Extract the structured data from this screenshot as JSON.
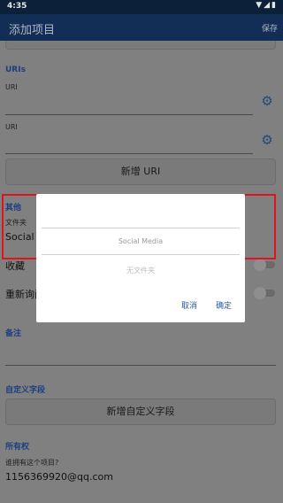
{
  "status_bar": {
    "time": "4:35",
    "icons": "▼◢▮"
  },
  "app_bar": {
    "title": "添加项目",
    "save": "保存"
  },
  "uris": {
    "title": "URIs",
    "fields": [
      {
        "label": "URI"
      },
      {
        "label": "URI"
      }
    ],
    "add_button": "新增 URI"
  },
  "other": {
    "title": "其他",
    "folder_label": "文件夹",
    "folder_value": "Social M",
    "favorite_label": "收藏",
    "reprompt_label": "重新询问"
  },
  "notes": {
    "title": "备注"
  },
  "custom_fields": {
    "title": "自定义字段",
    "add_button": "新增自定义字段"
  },
  "ownership": {
    "title": "所有权",
    "question": "谁拥有这个项目?",
    "owner": "1156369920@qq.com"
  },
  "dialog": {
    "folder_option": "Social Media",
    "no_folder": "无文件夹",
    "cancel": "取消",
    "ok": "确定"
  },
  "colors": {
    "accent": "#1b3f82",
    "highlight": "#e0141e",
    "dialog_button": "#2a5aa8"
  }
}
